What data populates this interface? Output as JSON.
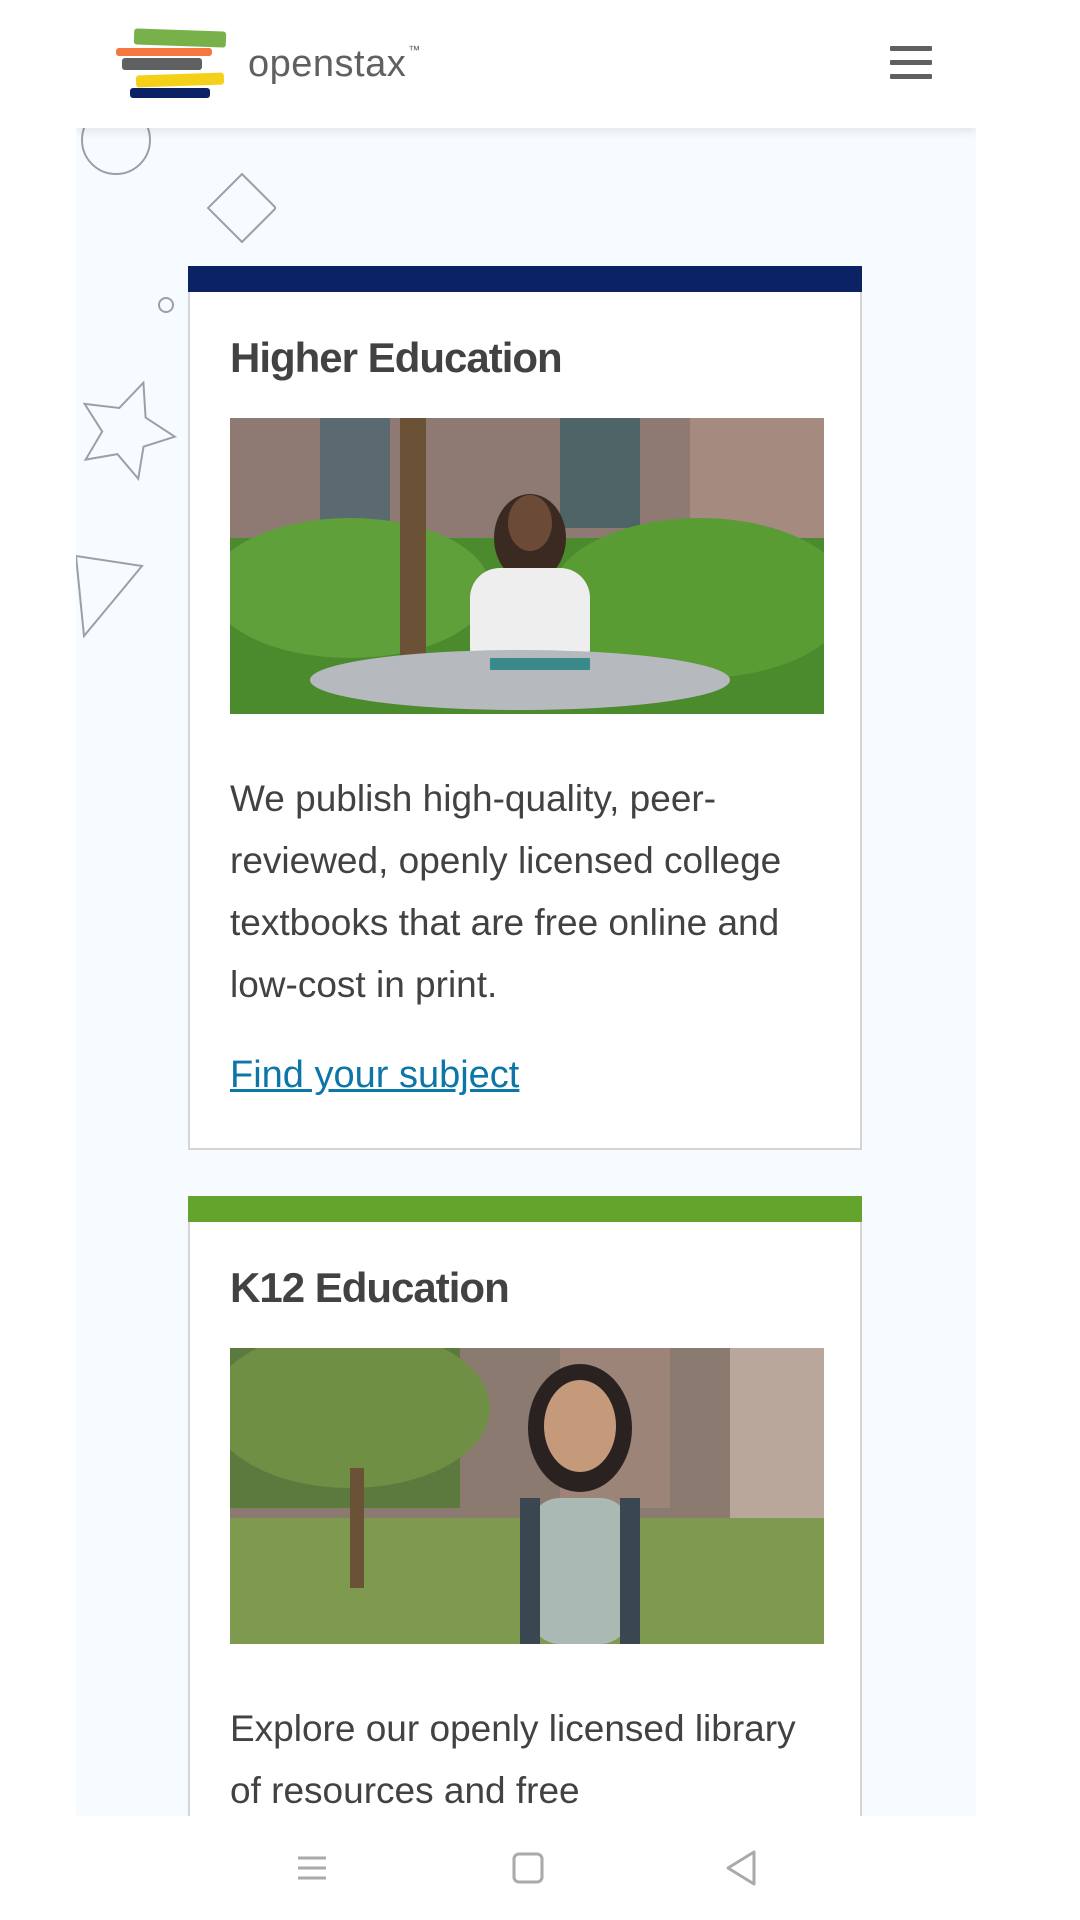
{
  "header": {
    "logo_text": "openstax",
    "menu_icon": "hamburger-menu-icon"
  },
  "cards": [
    {
      "title": "Higher Education",
      "bar_color": "#0b2265",
      "photo_description_icon": "photo-student-at-table",
      "text": "We publish high-quality, peer-reviewed, openly licensed college textbooks that are free online and low-cost in print.",
      "link": "Find your subject"
    },
    {
      "title": "K12 Education",
      "bar_color": "#64a42c",
      "photo_description_icon": "photo-student-with-backpack",
      "text": "Explore our openly licensed library of resources and free"
    }
  ],
  "system_nav": {
    "recents_icon": "recents-icon",
    "home_icon": "home-icon",
    "back_icon": "back-icon"
  },
  "colors": {
    "link": "#0c76a8",
    "background": "#f5fbfe",
    "text": "#424242"
  }
}
